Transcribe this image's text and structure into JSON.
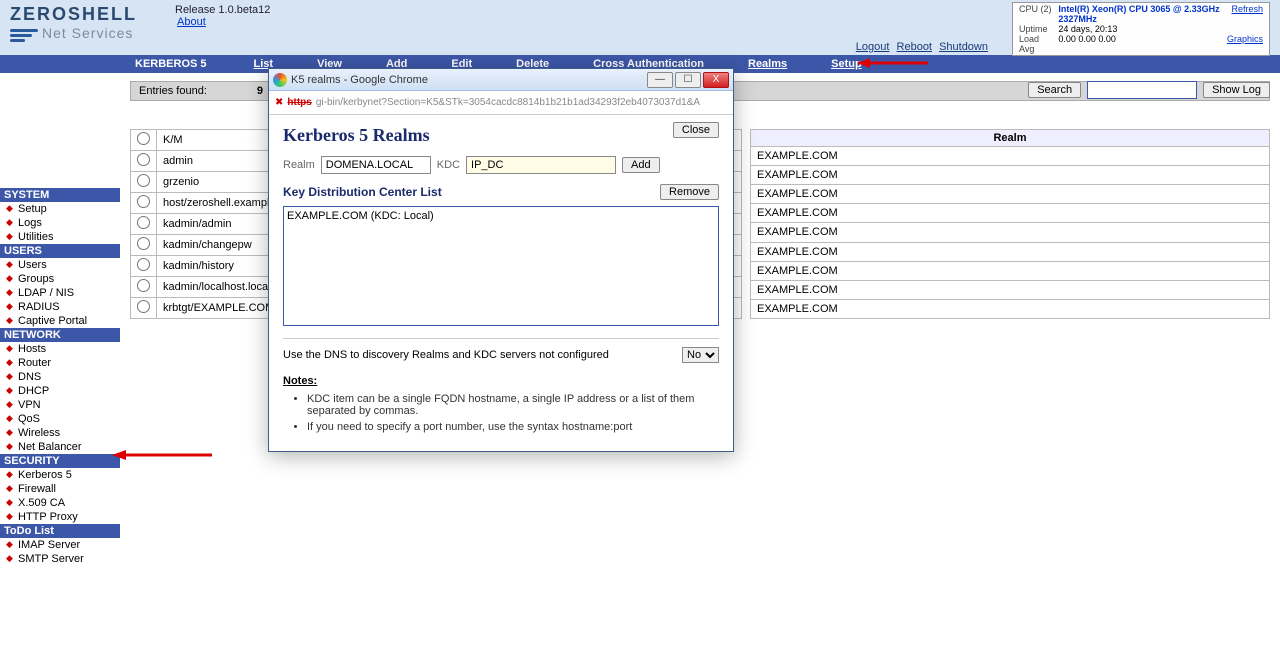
{
  "header": {
    "logo_title": "ZEROSHELL",
    "logo_sub": "Net Services",
    "release": "Release 1.0.beta12",
    "about": "About"
  },
  "sysinfo": {
    "cpu_label": "CPU (2)",
    "cpu_value": "Intel(R) Xeon(R) CPU 3065 @ 2.33GHz 2327MHz",
    "uptime_label": "Uptime",
    "uptime_value": "24 days, 20:13",
    "load_label": "Load Avg",
    "load_value": "0.00 0.00 0.00",
    "refresh": "Refresh",
    "graphics": "Graphics"
  },
  "toplinks": {
    "logout": "Logout",
    "reboot": "Reboot",
    "shutdown": "Shutdown"
  },
  "menu": {
    "title": "KERBEROS 5",
    "items": [
      "List",
      "View",
      "Add",
      "Edit",
      "Delete",
      "Cross Authentication",
      "Realms",
      "Setup"
    ]
  },
  "sidebar": [
    {
      "head": "SYSTEM",
      "items": [
        "Setup",
        "Logs",
        "Utilities"
      ]
    },
    {
      "head": "USERS",
      "items": [
        "Users",
        "Groups",
        "LDAP / NIS",
        "RADIUS",
        "Captive Portal"
      ]
    },
    {
      "head": "NETWORK",
      "items": [
        "Hosts",
        "Router",
        "DNS",
        "DHCP",
        "VPN",
        "QoS",
        "Wireless",
        "Net Balancer"
      ]
    },
    {
      "head": "SECURITY",
      "items": [
        "Kerberos 5",
        "Firewall",
        "X.509 CA",
        "HTTP Proxy"
      ]
    },
    {
      "head": "ToDo List",
      "items": [
        "IMAP Server",
        "SMTP Server"
      ]
    }
  ],
  "main": {
    "entries_label": "Entries found:",
    "entries_count": "9",
    "search": "Search",
    "showlog": "Show Log",
    "realm_header": "Realm",
    "principals": [
      "K/M",
      "admin",
      "grzenio",
      "host/zeroshell.example.com",
      "kadmin/admin",
      "kadmin/changepw",
      "kadmin/history",
      "kadmin/localhost.localdomain",
      "krbtgt/EXAMPLE.COM"
    ],
    "realms": [
      "EXAMPLE.COM",
      "EXAMPLE.COM",
      "EXAMPLE.COM",
      "EXAMPLE.COM",
      "EXAMPLE.COM",
      "EXAMPLE.COM",
      "EXAMPLE.COM",
      "EXAMPLE.COM",
      "EXAMPLE.COM"
    ]
  },
  "popup": {
    "window_title": "K5 realms - Google Chrome",
    "url_https": "https",
    "url_rest": "gi-bin/kerbynet?Section=K5&STk=3054cacdc8814b1b21b1ad34293f2eb4073037d1&A",
    "heading": "Kerberos 5 Realms",
    "close": "Close",
    "realm_label": "Realm",
    "realm_value": "DOMENA.LOCAL",
    "kdc_label": "KDC",
    "kdc_value": "IP_DC",
    "add": "Add",
    "kdc_list_heading": "Key Distribution Center List",
    "remove": "Remove",
    "kdc_entry": "EXAMPLE.COM (KDC: Local)",
    "dns_text": "Use the DNS to discovery Realms and KDC servers not configured",
    "dns_value": "No",
    "notes_heading": "Notes:",
    "notes": [
      "KDC item can be a single FQDN hostname, a single IP address or a list of them separated by commas.",
      "If you need to specify a port number, use the syntax hostname:port"
    ]
  }
}
